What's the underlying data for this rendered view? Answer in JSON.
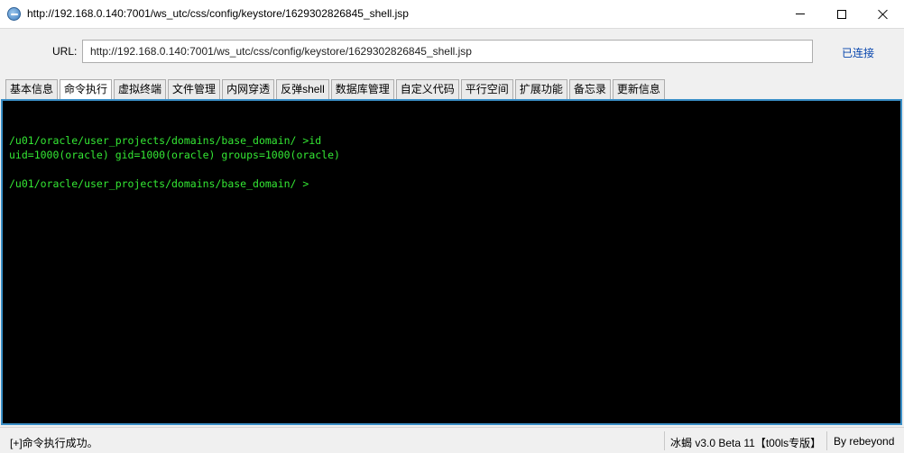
{
  "window": {
    "title": "http://192.168.0.140:7001/ws_utc/css/config/keystore/1629302826845_shell.jsp"
  },
  "urlbar": {
    "label": "URL:",
    "value": "http://192.168.0.140:7001/ws_utc/css/config/keystore/1629302826845_shell.jsp",
    "status": "已连接"
  },
  "tabs": [
    {
      "label": "基本信息",
      "active": false
    },
    {
      "label": "命令执行",
      "active": true
    },
    {
      "label": "虚拟终端",
      "active": false
    },
    {
      "label": "文件管理",
      "active": false
    },
    {
      "label": "内网穿透",
      "active": false
    },
    {
      "label": "反弹shell",
      "active": false
    },
    {
      "label": "数据库管理",
      "active": false
    },
    {
      "label": "自定义代码",
      "active": false
    },
    {
      "label": "平行空间",
      "active": false
    },
    {
      "label": "扩展功能",
      "active": false
    },
    {
      "label": "备忘录",
      "active": false
    },
    {
      "label": "更新信息",
      "active": false
    }
  ],
  "terminal": {
    "lines": [
      "/u01/oracle/user_projects/domains/base_domain/ >id",
      "uid=1000(oracle) gid=1000(oracle) groups=1000(oracle)",
      "",
      "/u01/oracle/user_projects/domains/base_domain/ >"
    ],
    "text_color": "#34e834",
    "background": "#000000"
  },
  "statusbar": {
    "message": "[+]命令执行成功。",
    "version": "冰蝎 v3.0 Beta 11【t00ls专版】",
    "author": "By rebeyond"
  }
}
